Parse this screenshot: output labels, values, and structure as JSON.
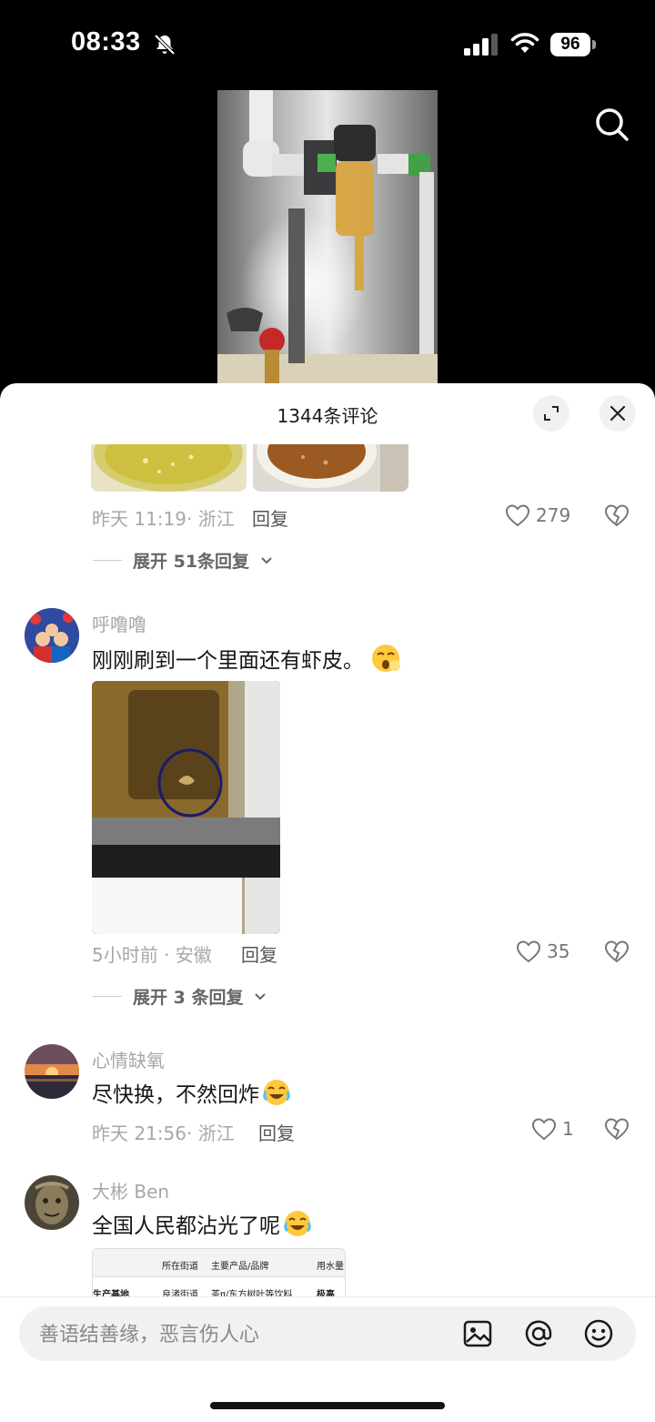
{
  "status": {
    "time": "08:33",
    "battery": "96"
  },
  "sheet": {
    "title": "1344条评论",
    "input_placeholder": "善语结善缘，恶言伤人心"
  },
  "comments": [
    {
      "meta": "昨天 11:19· 浙江",
      "reply": "回复",
      "likes": "279",
      "expand": "展开 51条回复"
    },
    {
      "user": "呼噜噜",
      "text": "刚刚刷到一个里面还有虾皮。",
      "meta": "5小时前 · 安徽",
      "reply": "回复",
      "likes": "35",
      "expand": "展开 3 条回复"
    },
    {
      "user": "心情缺氧",
      "text": "尽快换，不然回炸",
      "meta": "昨天 21:56· 浙江",
      "reply": "回复",
      "likes": "1"
    },
    {
      "user": "大彬 Ben",
      "text": "全国人民都沾光了呢",
      "table": {
        "headers": [
          "所在街道",
          "主要产品/品牌",
          "用水量"
        ],
        "row": [
          "生产基地",
          "良渚街道",
          "茶π/东方树叶等饮料",
          "极高"
        ]
      }
    }
  ]
}
